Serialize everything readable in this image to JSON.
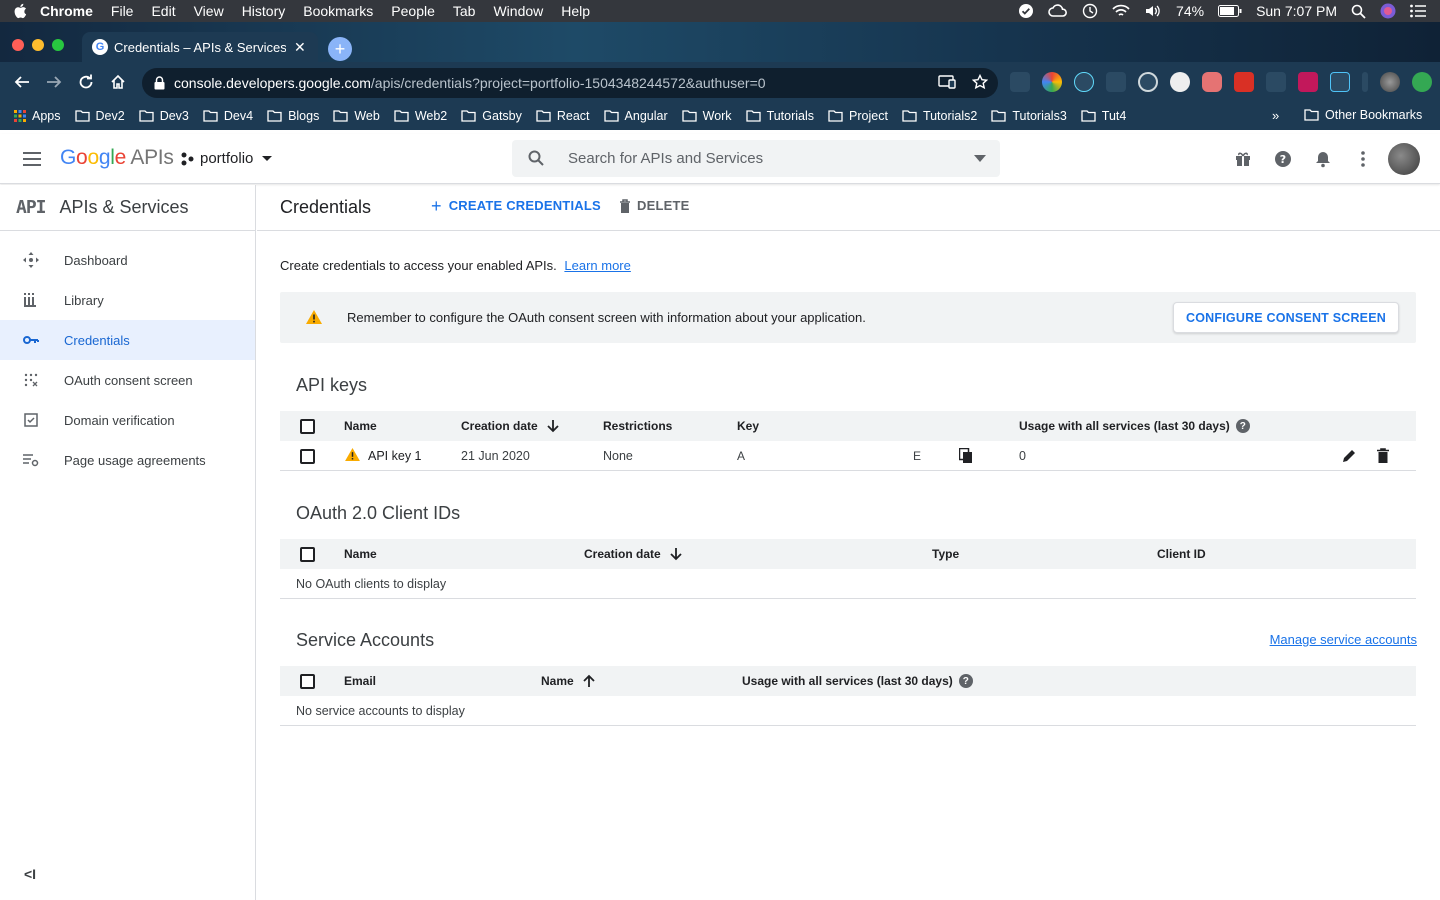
{
  "macos": {
    "app_name": "Chrome",
    "menu": [
      "File",
      "Edit",
      "View",
      "History",
      "Bookmarks",
      "People",
      "Tab",
      "Window",
      "Help"
    ],
    "battery": "74%",
    "clock": "Sun 7:07 PM"
  },
  "browser": {
    "tab_title": "Credentials – APIs & Services –",
    "url_host": "console.developers.google.com",
    "url_path": "/apis/credentials?project=portfolio-1504348244572&authuser=0",
    "bookmarks": [
      "Apps",
      "Dev2",
      "Dev3",
      "Dev4",
      "Blogs",
      "Web",
      "Web2",
      "Gatsby",
      "React",
      "Angular",
      "Work",
      "Tutorials",
      "Project",
      "Tutorials2",
      "Tutorials3",
      "Tut4"
    ],
    "bookmarks_more": "»",
    "other_bookmarks": "Other Bookmarks"
  },
  "header": {
    "logo_google": "Google",
    "logo_apis": "APIs",
    "project": "portfolio",
    "search_placeholder": "Search for APIs and Services"
  },
  "sidebar": {
    "badge": "API",
    "title": "APIs & Services",
    "items": [
      {
        "label": "Dashboard",
        "icon": "dashboard-icon"
      },
      {
        "label": "Library",
        "icon": "library-icon"
      },
      {
        "label": "Credentials",
        "icon": "key-icon",
        "active": true
      },
      {
        "label": "OAuth consent screen",
        "icon": "consent-icon"
      },
      {
        "label": "Domain verification",
        "icon": "domain-check-icon"
      },
      {
        "label": "Page usage agreements",
        "icon": "settings-list-icon"
      }
    ],
    "collapse": "<I"
  },
  "main": {
    "title": "Credentials",
    "create_label": "CREATE CREDENTIALS",
    "delete_label": "DELETE",
    "intro_text": "Create credentials to access your enabled APIs.",
    "learn_more": "Learn more",
    "notice_text": "Remember to configure the OAuth consent screen with information about your application.",
    "configure_label": "CONFIGURE CONSENT SCREEN"
  },
  "api_keys": {
    "title": "API keys",
    "columns": {
      "name": "Name",
      "creation": "Creation date",
      "restrictions": "Restrictions",
      "key": "Key",
      "usage": "Usage with all services (last 30 days)"
    },
    "rows": [
      {
        "name": "API key 1",
        "creation": "21 Jun 2020",
        "restrictions": "None",
        "key_start": "A",
        "key_end": "E",
        "usage": "0"
      }
    ]
  },
  "oauth": {
    "title": "OAuth 2.0 Client IDs",
    "columns": {
      "name": "Name",
      "creation": "Creation date",
      "type": "Type",
      "client_id": "Client ID"
    },
    "empty": "No OAuth clients to display"
  },
  "service_accounts": {
    "title": "Service Accounts",
    "manage_link": "Manage service accounts",
    "columns": {
      "email": "Email",
      "name": "Name",
      "usage": "Usage with all services (last 30 days)"
    },
    "empty": "No service accounts to display"
  },
  "colors": {
    "accent": "#1a73e8",
    "active_nav_bg": "#e8f0fe",
    "warning": "#f9ab00"
  }
}
